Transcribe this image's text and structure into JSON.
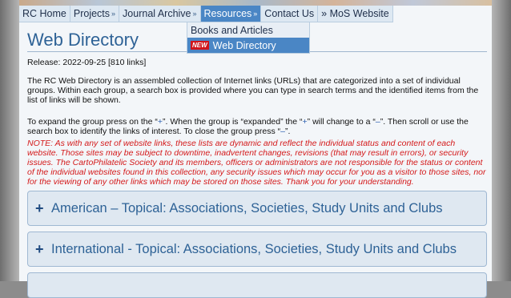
{
  "nav": {
    "items": [
      {
        "label": "RC Home"
      },
      {
        "label": "Projects"
      },
      {
        "label": "Journal Archive"
      },
      {
        "label": "Resources"
      },
      {
        "label": "Contact Us"
      },
      {
        "label": "» MoS Website"
      }
    ]
  },
  "dropdown": {
    "items": [
      {
        "label": "Books and Articles"
      },
      {
        "label": "Web Directory",
        "badge": "NEW"
      }
    ]
  },
  "page": {
    "title": "Web Directory",
    "release": "Release: 2022-09-25 [810 links]",
    "intro": "The RC Web Directory is an assembled collection of Internet links (URLs) that are categorized into a set of individual groups. Within each group, a search box is provided where you can type in search terms and the identified items from the list of links will be shown.",
    "expand": {
      "part1": "To expand the group press on the “",
      "plus1": "+",
      "part2": "”.  When the group is “expanded” the “",
      "plus2": "+",
      "part3": "” will change to a “",
      "minus1": "–",
      "part4": "”.  Then scroll or use the search box to identify the links of interest. To close the group press “",
      "minus2": "–",
      "part5": "”."
    },
    "note": "NOTE: As with any set of website links, these lists are dynamic and reflect the individual status and content of each website. Those sites may be subject to downtime, inadvertent changes, revisions (that may result in errors), or security issues. The CartoPhilatelic Society and its members, officers or administrators are not responsible for the status or content of the individual websites found in this collection, any security issues which may occur for you as a visitor to those sites, nor for the viewing of any other links which may be stored on those sites. Thank you for your understanding."
  },
  "groups": [
    {
      "label": "American – Topical: Associations, Societies, Study Units and Clubs",
      "toggle": "+"
    },
    {
      "label": "International - Topical: Associations, Societies, Study Units and Clubs",
      "toggle": "+"
    }
  ],
  "colors": {
    "accent": "#4a86c5",
    "title": "#2e6296",
    "note": "#d4191a",
    "new_badge": "#d0151b"
  }
}
